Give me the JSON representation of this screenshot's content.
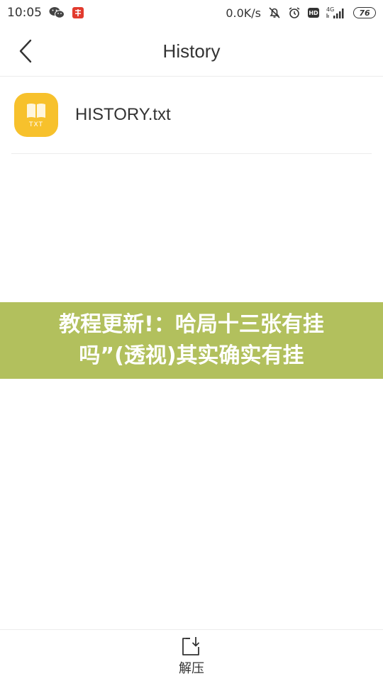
{
  "status_bar": {
    "time": "10:05",
    "net_speed": "0.0K/s",
    "hd": "HD",
    "network_type": "4G",
    "battery": "76"
  },
  "header": {
    "title": "History"
  },
  "files": [
    {
      "name": "HISTORY.txt",
      "icon_label": "TXT",
      "icon_color": "#f7c12c"
    }
  ],
  "banner": {
    "text": "教程更新!：哈局十三张有挂吗”(透视)其实确实有挂",
    "background": "#b2c05d"
  },
  "bottom_bar": {
    "extract_label": "解压"
  }
}
